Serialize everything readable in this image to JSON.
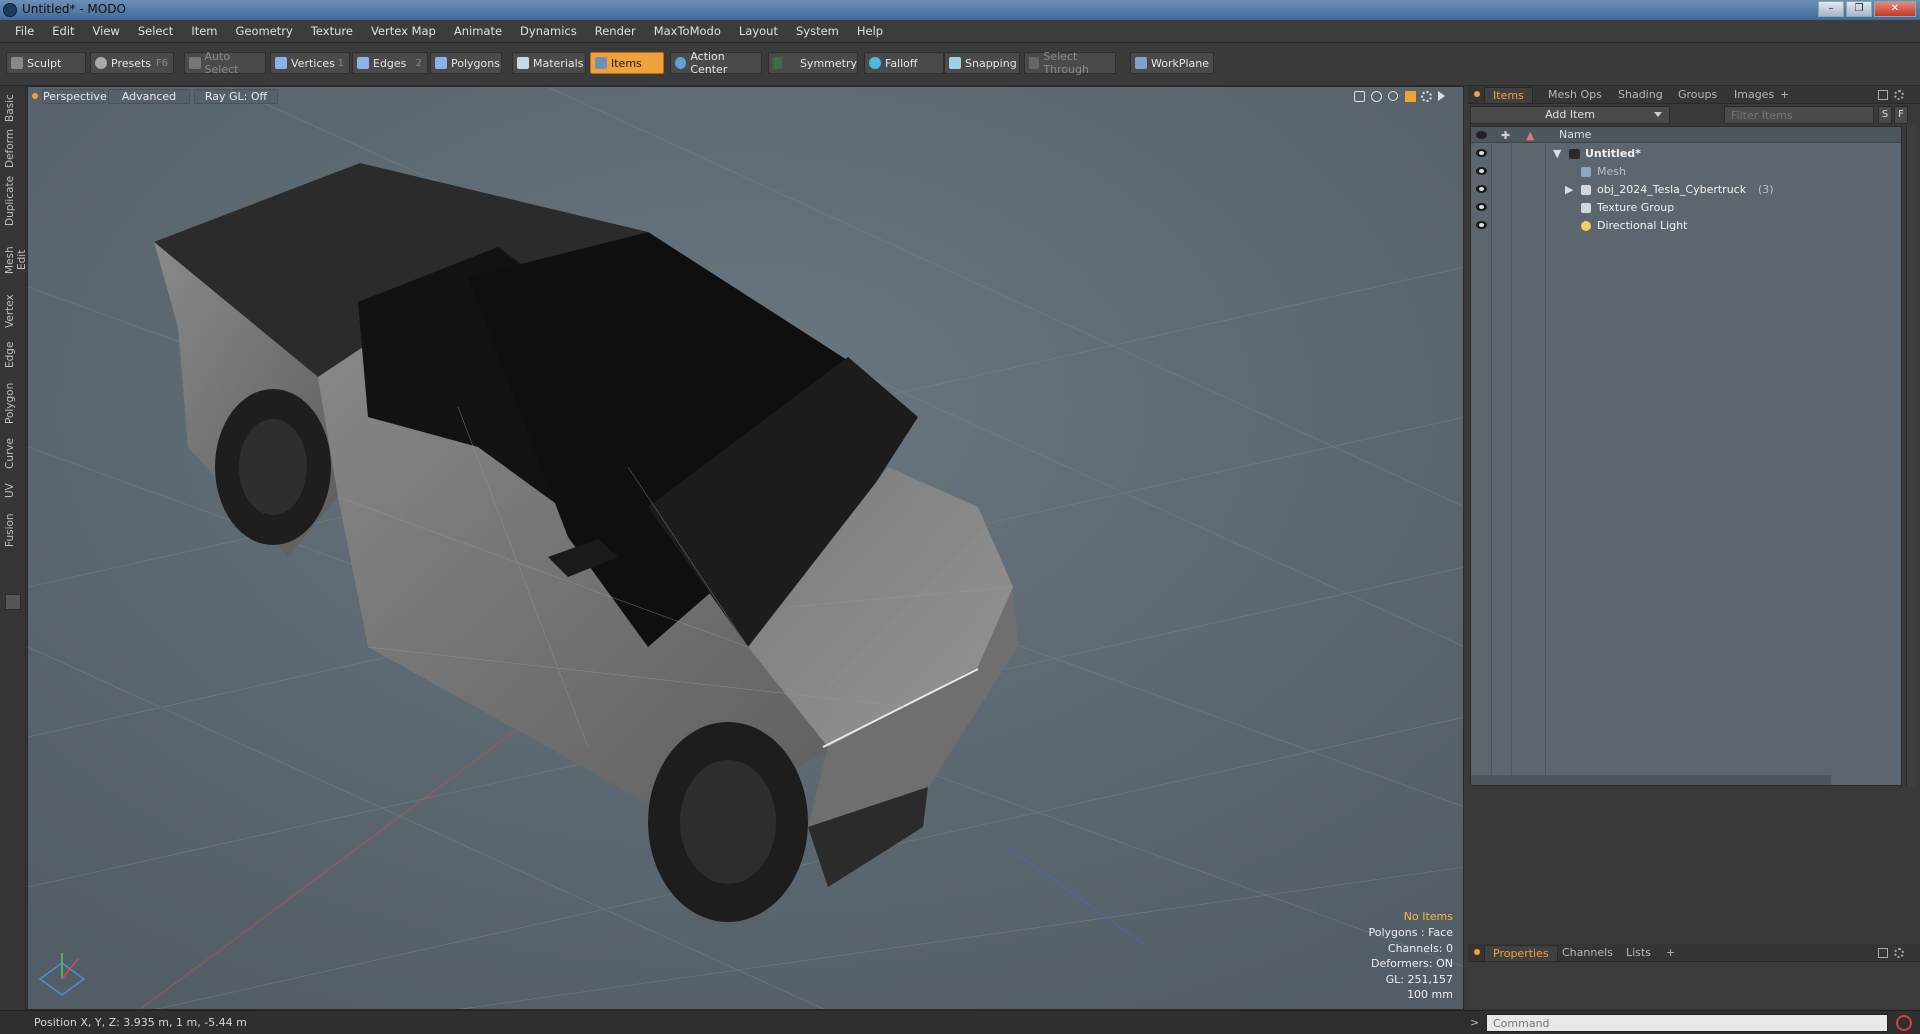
{
  "window": {
    "title": "Untitled* - MODO",
    "controls": [
      "–",
      "❐",
      "✕"
    ]
  },
  "menu": [
    "File",
    "Edit",
    "View",
    "Select",
    "Item",
    "Geometry",
    "Texture",
    "Vertex Map",
    "Animate",
    "Dynamics",
    "Render",
    "MaxToModo",
    "Layout",
    "System",
    "Help"
  ],
  "toolbar": {
    "sculpt": "Sculpt",
    "presets": "Presets",
    "presets_key": "F6",
    "auto_select": "Auto Select",
    "vertices": "Vertices",
    "vertices_key": "1",
    "edges": "Edges",
    "edges_key": "2",
    "polygons": "Polygons",
    "materials": "Materials",
    "items": "Items",
    "action_center": "Action Center",
    "symmetry": "Symmetry",
    "falloff": "Falloff",
    "snapping": "Snapping",
    "select_through": "Select Through",
    "workplane": "WorkPlane"
  },
  "left_tabs": [
    "Basic",
    "Deform",
    "Duplicate",
    "Mesh Edit",
    "Vertex",
    "Edge",
    "Polygon",
    "Curve",
    "UV",
    "Fusion"
  ],
  "viewport": {
    "view_mode": "Perspective",
    "shading": "Advanced",
    "raygl": "Ray GL: Off",
    "stats": {
      "selection": "No Items",
      "polygons": "Polygons : Face",
      "channels": "Channels: 0",
      "deformers": "Deformers: ON",
      "gl": "GL: 251,157",
      "unit": "100 mm"
    }
  },
  "status_bar": {
    "position": "Position X, Y, Z:   3.935 m, 1 m, -5.44 m"
  },
  "right_panel": {
    "tabs": [
      "Items",
      "Mesh Ops",
      "Shading",
      "Groups",
      "Images"
    ],
    "add_item": "Add Item",
    "filter_placeholder": "Filter Items",
    "filter_s": "S",
    "filter_f": "F",
    "column_name": "Name",
    "tree": [
      {
        "label": "Untitled*"
      },
      {
        "label": "Mesh"
      },
      {
        "label": "obj_2024_Tesla_Cybertruck",
        "count": "(3)"
      },
      {
        "label": "Texture Group"
      },
      {
        "label": "Directional Light"
      }
    ],
    "bottom_tabs": [
      "Properties",
      "Channels",
      "Lists"
    ],
    "command_placeholder": "Command"
  },
  "colors": {
    "accent": "#f0a23a",
    "viewport_bg": "#5f6b74",
    "panel_bg": "#3a3a3a"
  }
}
